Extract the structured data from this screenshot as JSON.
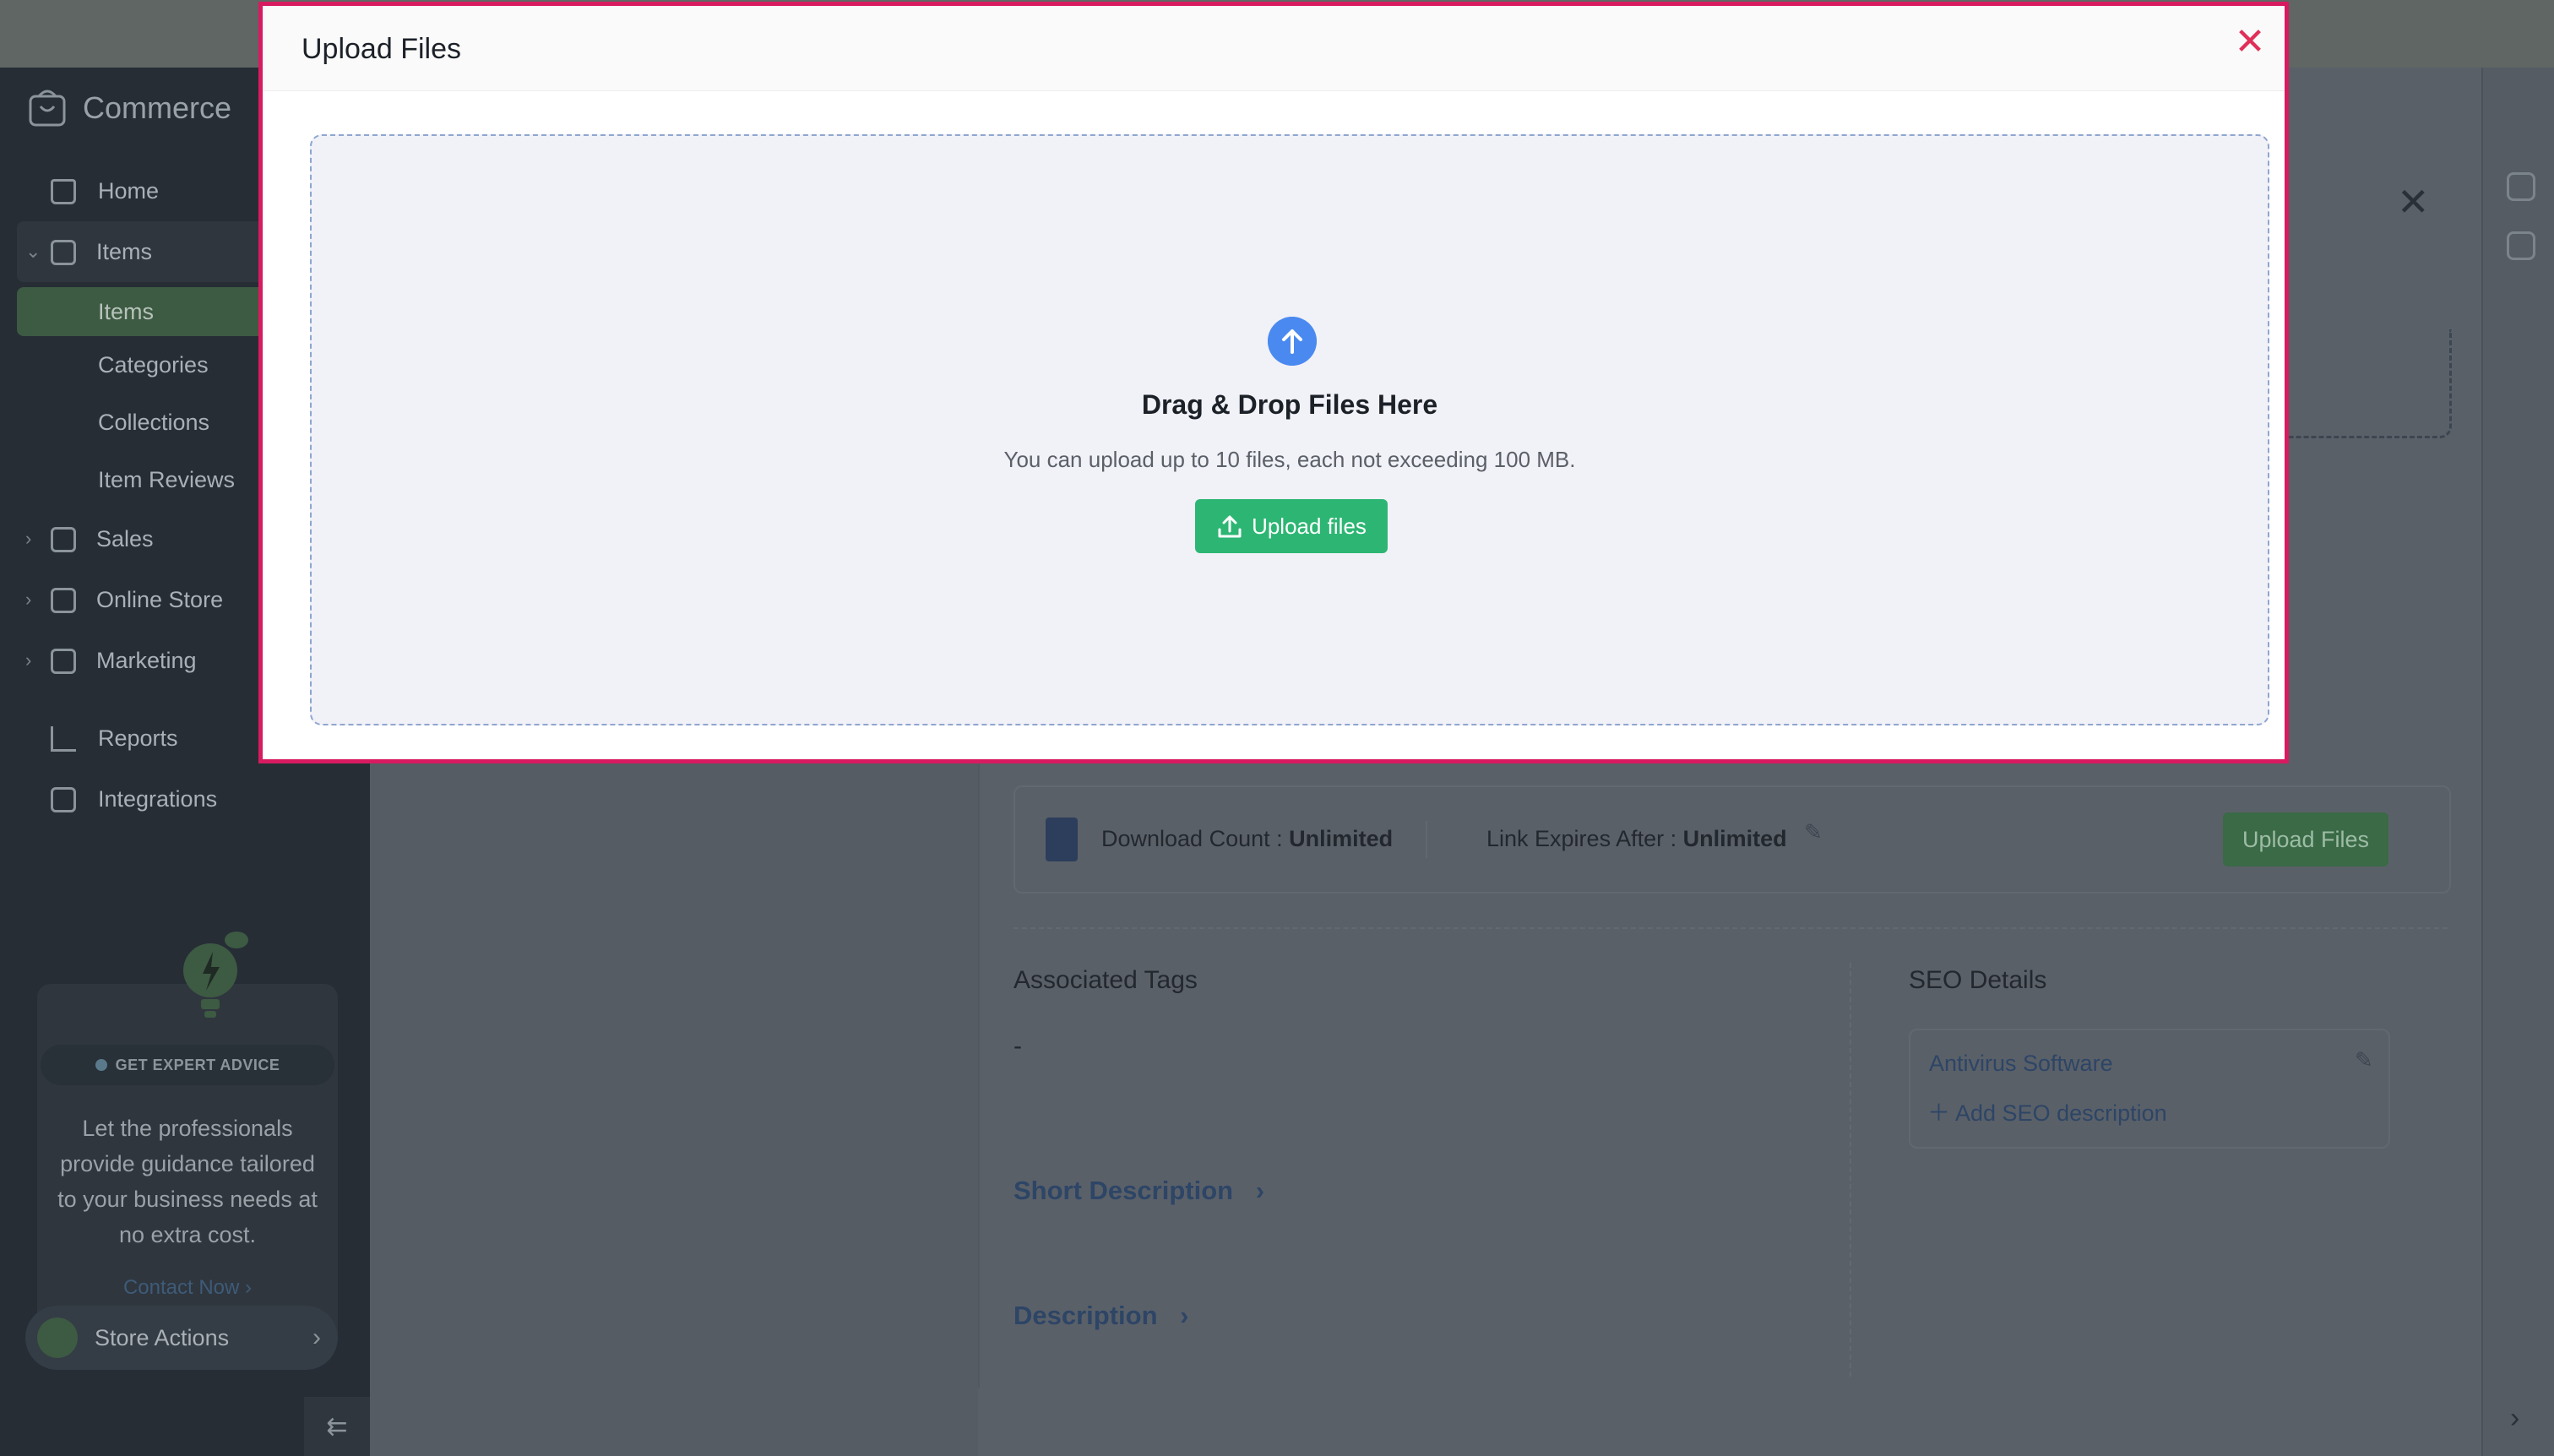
{
  "app": {
    "brand": "Commerce"
  },
  "sidebar": {
    "items": [
      {
        "label": "Home"
      },
      {
        "label": "Items"
      },
      {
        "label": "Items"
      },
      {
        "label": "Categories"
      },
      {
        "label": "Collections"
      },
      {
        "label": "Item Reviews"
      },
      {
        "label": "Sales"
      },
      {
        "label": "Online Store"
      },
      {
        "label": "Marketing"
      },
      {
        "label": "Reports"
      },
      {
        "label": "Integrations"
      }
    ],
    "advice": {
      "badge": "GET EXPERT ADVICE",
      "text": "Let the professionals provide guidance tailored to your business needs at no extra cost.",
      "contact": "Contact Now"
    },
    "store_actions": "Store Actions"
  },
  "content": {
    "download_count_label": "Download Count :",
    "download_count_value": "Unlimited",
    "link_expires_label": "Link Expires After :",
    "link_expires_value": "Unlimited",
    "upload_files_button": "Upload Files",
    "associated_tags_title": "Associated Tags",
    "associated_tags_value": "-",
    "seo_title": "SEO Details",
    "seo_name": "Antivirus Software",
    "seo_add": "Add SEO description",
    "short_description": "Short Description",
    "description": "Description"
  },
  "modal": {
    "title": "Upload Files",
    "dropzone_title": "Drag & Drop Files Here",
    "dropzone_subtitle": "You can upload up to 10 files, each not exceeding 100 MB.",
    "upload_button": "Upload files"
  },
  "colors": {
    "modal_border": "#d81b60",
    "upload_green": "#2db673",
    "upload_icon_blue": "#4a8af0"
  }
}
